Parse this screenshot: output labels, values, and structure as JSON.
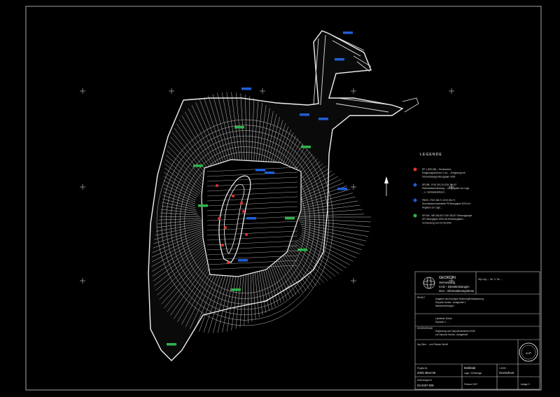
{
  "colors": {
    "background": "#000000",
    "linework": "#e8e8e8",
    "frame": "#cfcfcf",
    "red_marker": "#e0312b",
    "blue_marker": "#1f5fd6",
    "green_marker": "#2fb54a",
    "north_arrow": "#ffffff"
  },
  "legend": {
    "title": "LEGENDE",
    "items": [
      {
        "symbol": "red-dot",
        "text": "SP 1 (SPL/05) – Technisches Entgasungsbrunnen 1 zur ...-Entgasung mit Ortsrandspiegel Bezugsjahr 2003"
      },
      {
        "symbol": "blue-diamond",
        "text": "SP1/98 - POK 291,24 GOK 290,67 Sickerwassermessung ... mit Angaben zur Lage ... u. Gebäudeabstand ..."
      },
      {
        "symbol": "blue-diamond",
        "text": "PB/05 - POK 265,71 GOK 264,71 Grundwassermessstelle P5 Bezugsjahr 2003 mit Angaben zur Lage ..."
      },
      {
        "symbol": "green-dot",
        "text": "SP1/06 - MB 264,637 GOK 263,97 Setzungspegel SP1 Bezugsjahr 2006 mit Höhenangaben ... Vermessung vom 20.09.2006"
      }
    ]
  },
  "titleblock": {
    "company": "GEOKDIN",
    "company_lines": [
      "Vermessung",
      "CAD - Dienstleistungen",
      "Geo - Informationssysteme"
    ],
    "contact": "Dipl.-Ing. ... Str. 3, Tel. ...",
    "section1_label": "INHALT",
    "section1_lines": [
      "Angaben nach Analyse Sickerung/Entwässerung",
      "Deponie Hunfra - Anlagenteil 1",
      "Messeinrichtungen"
    ],
    "section2_lines": [
      "Landkreis Dixlob",
      "Deponie 2 - ..."
    ],
    "section3_label": "GEGENSTAND",
    "section3_lines": [
      "Ergänzung zum Deponieverfahren 2006",
      "zur Deponie Hunfra - Anlagenteil"
    ],
    "client_line": "Ing.-Büro ... und Partner GmbH",
    "project_label": "Projekt-Nr.",
    "project_value": "2003-4844-09",
    "scale_label": "Maßstab",
    "scale_value": "1:1000",
    "drawing_label": "Zeichnungs-Nr.",
    "drawing_value": "03-2007-005",
    "view_label": "Lage / Höhenlage",
    "checked_label": "Gezeichnet",
    "date_value": "Februar 2007",
    "sheet_value": "Anlage 9",
    "logo_text": "A+P"
  }
}
